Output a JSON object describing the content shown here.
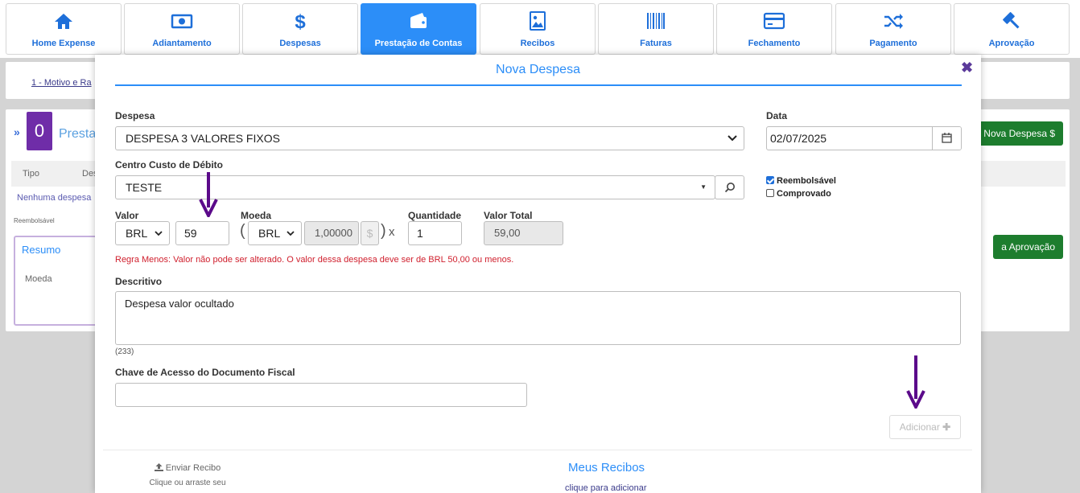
{
  "nav": {
    "tabs": [
      {
        "label": "Home Expense",
        "icon": "home-icon"
      },
      {
        "label": "Adiantamento",
        "icon": "money-icon"
      },
      {
        "label": "Despesas",
        "icon": "dollar-icon"
      },
      {
        "label": "Prestação de Contas",
        "icon": "wallet-icon",
        "active": true
      },
      {
        "label": "Recibos",
        "icon": "image-icon"
      },
      {
        "label": "Faturas",
        "icon": "barcode-icon"
      },
      {
        "label": "Fechamento",
        "icon": "card-icon"
      },
      {
        "label": "Pagamento",
        "icon": "shuffle-icon"
      },
      {
        "label": "Aprovação",
        "icon": "gavel-icon"
      }
    ]
  },
  "background": {
    "breadcrumb": "1 - Motivo e Ra",
    "badge": "0",
    "title": "Prestaç",
    "new_button": "Nova Despesa $",
    "approve_button": "a Aprovação",
    "col_tipo": "Tipo",
    "col_des": "Des",
    "nenhuma": "Nenhuma despesa",
    "reemb": "Reembolsável",
    "resumo": "Resumo",
    "moeda": "Moeda"
  },
  "modal": {
    "title": "Nova Despesa",
    "despesa_label": "Despesa",
    "despesa_value": "DESPESA 3 VALORES FIXOS",
    "data_label": "Data",
    "data_value": "02/07/2025",
    "centro_label": "Centro Custo de Débito",
    "centro_value": "TESTE",
    "reembolsavel": "Reembolsável",
    "comprovado": "Comprovado",
    "valor_label": "Valor",
    "valor_currency": "BRL",
    "valor_value": "59",
    "moeda_label": "Moeda",
    "moeda_currency": "BRL",
    "moeda_rate": "1,00000",
    "rate_symbol": "$",
    "multiply": "x",
    "quantidade_label": "Quantidade",
    "quantidade_value": "1",
    "total_label": "Valor Total",
    "total_value": "59,00",
    "error": "Regra Menos: Valor não pode ser alterado. O valor dessa despesa deve ser de BRL 50,00 ou menos.",
    "descritivo_label": "Descritivo",
    "descritivo_value": "Despesa valor ocultado",
    "counter": "(233)",
    "chave_label": "Chave de Acesso do Documento Fiscal",
    "chave_value": "",
    "add_button": "Adicionar",
    "enviar_recibo": "Enviar Recibo",
    "clique_arraste": "Clique ou arraste seu",
    "meus_recibos": "Meus Recibos",
    "clique_adicionar": "clique para adicionar"
  },
  "colors": {
    "accent": "#2c8ef8",
    "nav_text": "#1e6fd9",
    "error": "#d0202e",
    "annotation_arrow": "#5b0a8a"
  }
}
